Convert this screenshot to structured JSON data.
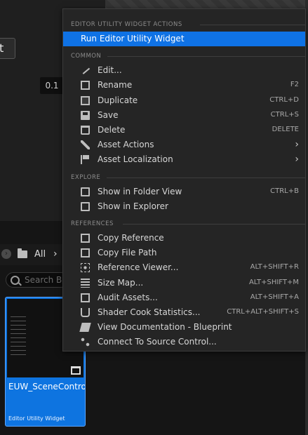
{
  "background": {
    "partial_button_text": "t",
    "value_box": "0.1"
  },
  "content_browser": {
    "breadcrumb_all": "All",
    "breadcrumb_chevron": "›",
    "search_placeholder": "Search B",
    "asset": {
      "name": "EUW_SceneControl",
      "type": "Editor Utility Widget"
    }
  },
  "context_menu": {
    "sections": [
      {
        "title": "EDITOR UTILITY WIDGET ACTIONS",
        "items": [
          {
            "label": "Run Editor Utility Widget",
            "shortcut": "",
            "submenu": false,
            "icon": "",
            "highlighted": true
          }
        ]
      },
      {
        "title": "COMMON",
        "items": [
          {
            "label": "Edit...",
            "shortcut": "",
            "submenu": false,
            "icon": "pencil-icon"
          },
          {
            "label": "Rename",
            "shortcut": "F2",
            "submenu": false,
            "icon": "rename-icon"
          },
          {
            "label": "Duplicate",
            "shortcut": "CTRL+D",
            "submenu": false,
            "icon": "duplicate-icon"
          },
          {
            "label": "Save",
            "shortcut": "CTRL+S",
            "submenu": false,
            "icon": "save-icon"
          },
          {
            "label": "Delete",
            "shortcut": "DELETE",
            "submenu": false,
            "icon": "trash-icon"
          },
          {
            "label": "Asset Actions",
            "shortcut": "",
            "submenu": true,
            "icon": "wrench-icon"
          },
          {
            "label": "Asset Localization",
            "shortcut": "",
            "submenu": true,
            "icon": "flag-icon"
          }
        ]
      },
      {
        "title": "EXPLORE",
        "items": [
          {
            "label": "Show in Folder View",
            "shortcut": "CTRL+B",
            "submenu": false,
            "icon": "folder-view-icon"
          },
          {
            "label": "Show in Explorer",
            "shortcut": "",
            "submenu": false,
            "icon": "explorer-icon"
          }
        ]
      },
      {
        "title": "REFERENCES",
        "items": [
          {
            "label": "Copy Reference",
            "shortcut": "",
            "submenu": false,
            "icon": "copy-reference-icon"
          },
          {
            "label": "Copy File Path",
            "shortcut": "",
            "submenu": false,
            "icon": "copy-path-icon"
          },
          {
            "label": "Reference Viewer...",
            "shortcut": "ALT+SHIFT+R",
            "submenu": false,
            "icon": "reference-viewer-icon"
          },
          {
            "label": "Size Map...",
            "shortcut": "ALT+SHIFT+M",
            "submenu": false,
            "icon": "size-map-icon"
          },
          {
            "label": "Audit Assets...",
            "shortcut": "ALT+SHIFT+A",
            "submenu": false,
            "icon": "audit-icon"
          },
          {
            "label": "Shader Cook Statistics...",
            "shortcut": "CTRL+ALT+SHIFT+S",
            "submenu": false,
            "icon": "shader-icon"
          },
          {
            "label": "View Documentation - Blueprint",
            "shortcut": "",
            "submenu": false,
            "icon": "documentation-icon"
          },
          {
            "label": "Connect To Source Control...",
            "shortcut": "",
            "submenu": false,
            "icon": "source-control-icon"
          }
        ]
      }
    ],
    "submenu_arrow": "›",
    "highlight_color": "#0f72e5"
  }
}
